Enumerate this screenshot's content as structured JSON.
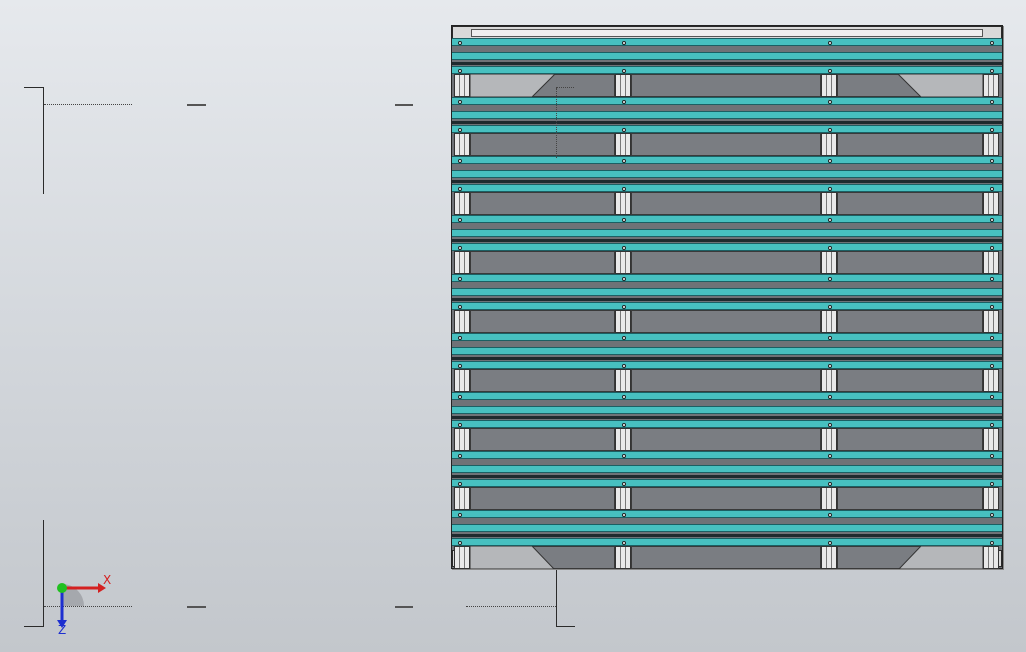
{
  "view": {
    "background_top": "#e6e9ed",
    "background_bottom": "#c3c7cc",
    "slat_color": "#47c0c0",
    "frame_color": "#d9d9d9"
  },
  "triad": {
    "x_label": "X",
    "z_label": "Z",
    "x_color": "#d42020",
    "y_color": "#20c020",
    "z_color": "#1d2fd0"
  },
  "assembly": {
    "rows": 9,
    "columns": 4
  }
}
